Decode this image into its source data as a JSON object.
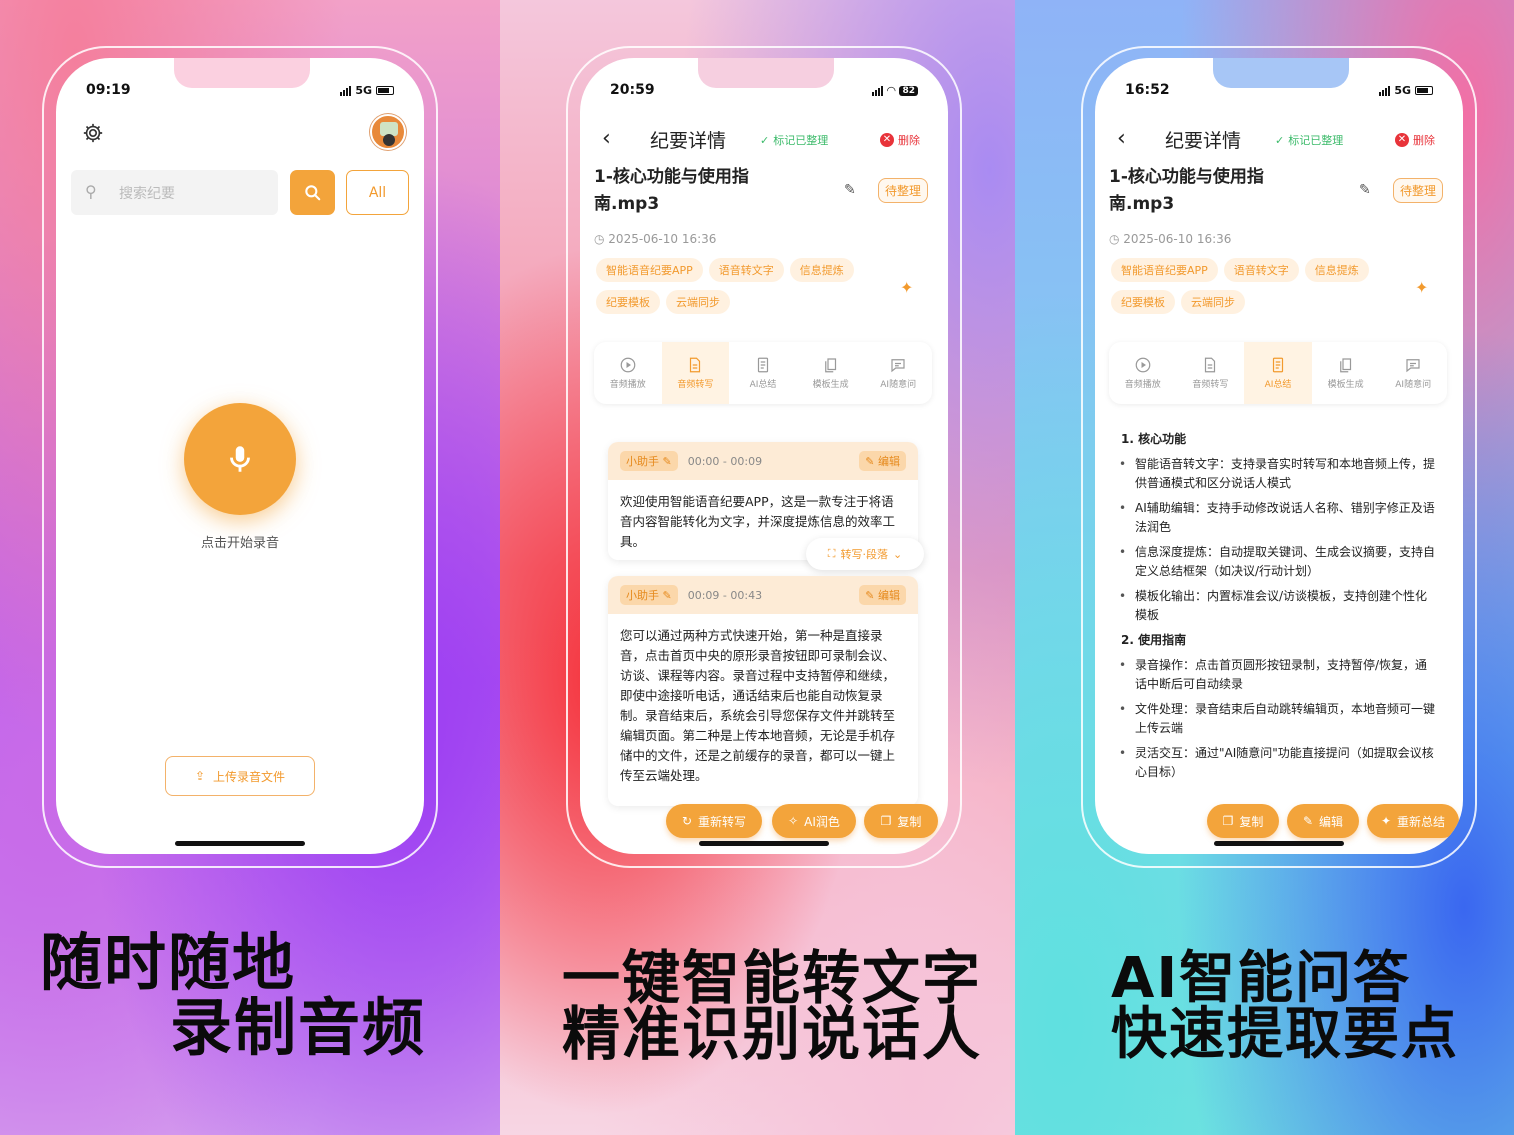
{
  "panel1": {
    "status": {
      "time": "09:19",
      "network": "5G"
    },
    "search": {
      "placeholder": "搜索纪要",
      "filter_label": "All"
    },
    "record": {
      "label": "点击开始录音"
    },
    "upload": {
      "label": "上传录音文件"
    },
    "caption": {
      "line1": "随时随地",
      "line2": "录制音频"
    }
  },
  "panel2": {
    "status": {
      "time": "20:59",
      "battery": "82"
    },
    "header": {
      "title": "纪要详情",
      "mark_done": "标记已整理",
      "delete": "删除"
    },
    "doc": {
      "title_line1": "1-核心功能与使用指",
      "title_line2": "南.mp3",
      "date": "2025-06-10 16:36",
      "state": "待整理"
    },
    "tags": [
      "智能语音纪要APP",
      "语音转文字",
      "信息提炼",
      "纪要模板",
      "云端同步"
    ],
    "tabs": [
      "音频播放",
      "音频转写",
      "AI总结",
      "模板生成",
      "AI随意问"
    ],
    "active_tab": 1,
    "segments": [
      {
        "speaker": "小助手",
        "time": "00:00 - 00:09",
        "edit": "编辑",
        "text": "欢迎使用智能语音纪要APP，这是一款专注于将语音内容智能转化为文字，并深度提炼信息的效率工具。"
      },
      {
        "speaker": "小助手",
        "time": "00:09 - 00:43",
        "edit": "编辑",
        "text": "您可以通过两种方式快速开始，第一种是直接录音，点击首页中央的原形录音按钮即可录制会议、访谈、课程等内容。录音过程中支持暂停和继续，即使中途接听电话，通话结束后也能自动恢复录制。录音结束后，系统会引导您保存文件并跳转至编辑页面。第二种是上传本地音频，无论是手机存储中的文件，还是之前缓存的录音，都可以一键上传至云端处理。"
      }
    ],
    "mode_toggle": "转写·段落",
    "actions": [
      "重新转写",
      "AI润色",
      "复制"
    ],
    "caption": {
      "line1": "一键智能转文字",
      "line2": "精准识别说话人"
    }
  },
  "panel3": {
    "status": {
      "time": "16:52",
      "network": "5G"
    },
    "header": {
      "title": "纪要详情",
      "mark_done": "标记已整理",
      "delete": "删除"
    },
    "doc": {
      "title_line1": "1-核心功能与使用指",
      "title_line2": "南.mp3",
      "date": "2025-06-10 16:36",
      "state": "待整理"
    },
    "tags": [
      "智能语音纪要APP",
      "语音转文字",
      "信息提炼",
      "纪要模板",
      "云端同步"
    ],
    "tabs": [
      "音频播放",
      "音频转写",
      "AI总结",
      "模板生成",
      "AI随意问"
    ],
    "active_tab": 2,
    "summary": {
      "h1": "1. 核心功能",
      "s1": [
        "智能语音转文字：支持录音实时转写和本地音频上传，提供普通模式和区分说话人模式",
        "AI辅助编辑：支持手动修改说话人名称、错别字修正及语法润色",
        "信息深度提炼：自动提取关键词、生成会议摘要，支持自定义总结框架（如决议/行动计划）",
        "模板化输出：内置标准会议/访谈模板，支持创建个性化模板"
      ],
      "h2": "2. 使用指南",
      "s2": [
        "录音操作：点击首页圆形按钮录制，支持暂停/恢复，通话中断后可自动续录",
        "文件处理：录音结束后自动跳转编辑页，本地音频可一键上传云端",
        "灵活交互：通过\"AI随意问\"功能直接提问（如提取会议核心目标）"
      ]
    },
    "actions": [
      "复制",
      "编辑",
      "重新总结"
    ],
    "caption": {
      "line1": "AI智能问答",
      "line2": "快速提取要点"
    }
  },
  "colors": {
    "accent": "#f3a43b",
    "accent_text": "#f29a2e",
    "tag_bg": "#fff1e0",
    "delete": "#e8333a",
    "done": "#3dbb6b"
  }
}
